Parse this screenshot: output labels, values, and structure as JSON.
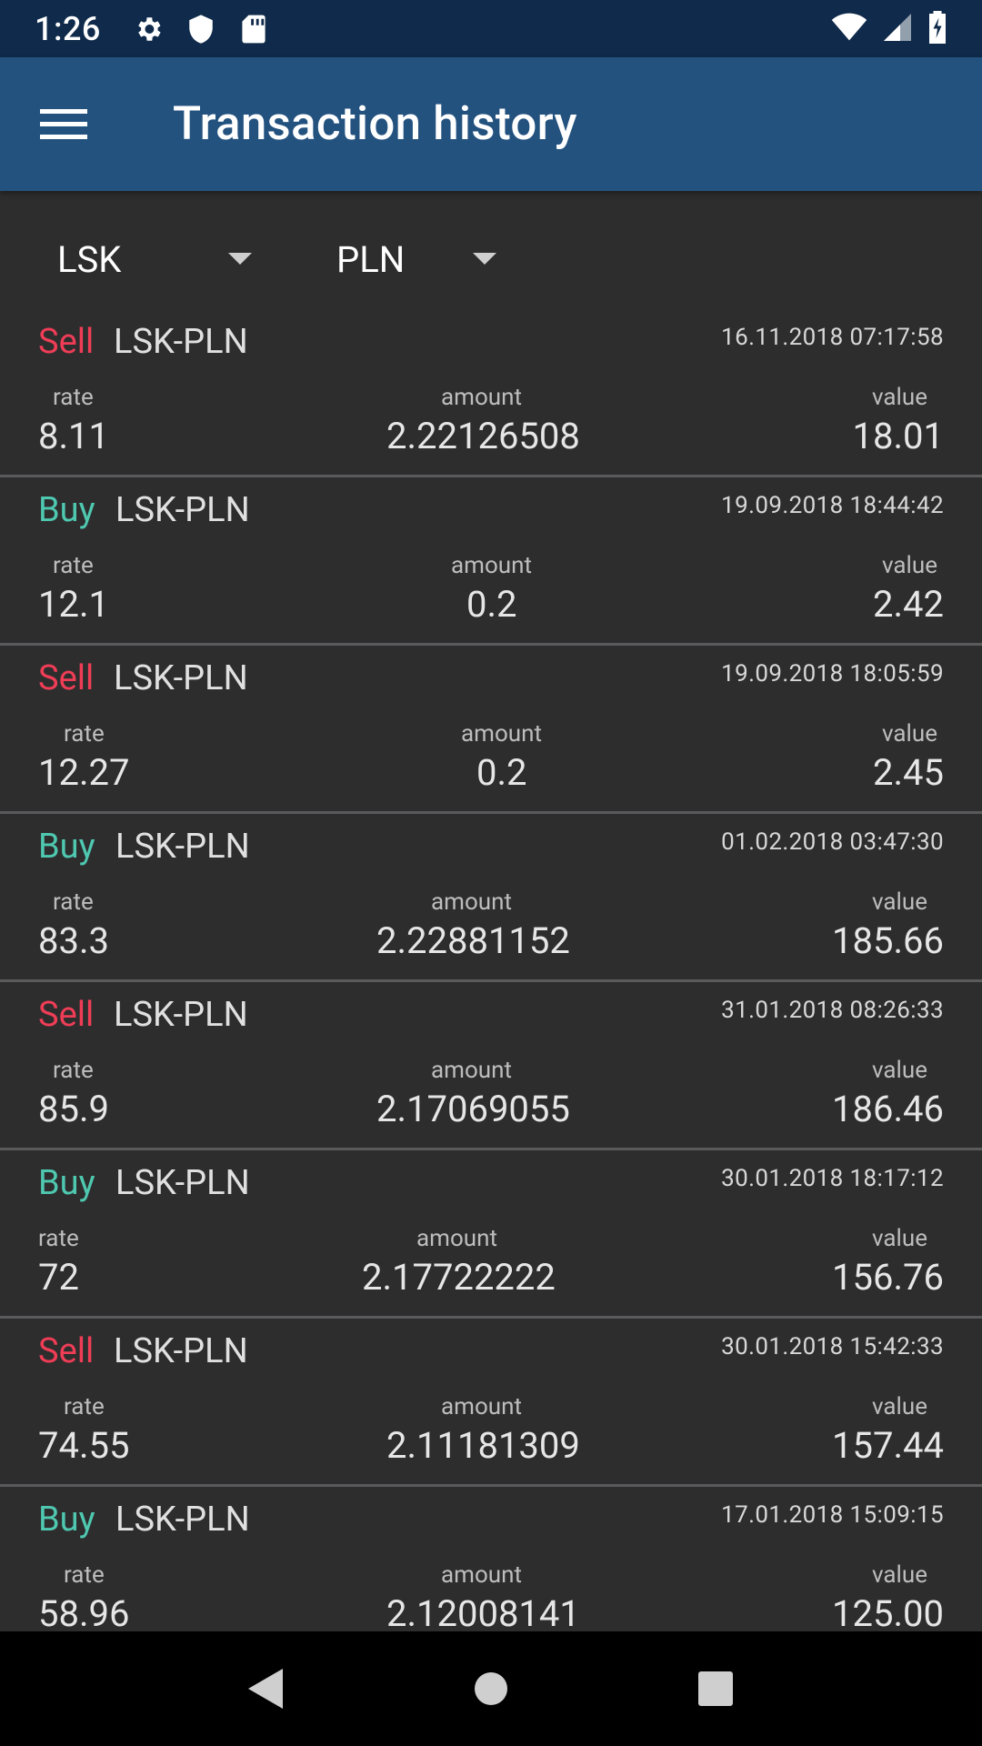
{
  "status_bar": {
    "time": "1:26",
    "icons": [
      "gear-icon",
      "shield-icon",
      "sd-card-icon",
      "wifi-icon",
      "signal-icon",
      "battery-icon"
    ]
  },
  "app_bar": {
    "title": "Transaction history",
    "menu_icon": "hamburger-menu-icon",
    "color": "#24527f"
  },
  "filters": {
    "currency": "LSK",
    "fiat": "PLN"
  },
  "labels": {
    "rate": "rate",
    "amount": "amount",
    "value": "value"
  },
  "colors": {
    "sell": "#ef3d56",
    "buy": "#4fc8b0",
    "background": "#2d2d2e"
  },
  "transactions": [
    {
      "side": "Sell",
      "pair": "LSK-PLN",
      "date": "16.11.2018 07:17:58",
      "rate": "8.11",
      "amount": "2.22126508",
      "value": "18.01"
    },
    {
      "side": "Buy",
      "pair": "LSK-PLN",
      "date": "19.09.2018 18:44:42",
      "rate": "12.1",
      "amount": "0.2",
      "value": "2.42"
    },
    {
      "side": "Sell",
      "pair": "LSK-PLN",
      "date": "19.09.2018 18:05:59",
      "rate": "12.27",
      "amount": "0.2",
      "value": "2.45"
    },
    {
      "side": "Buy",
      "pair": "LSK-PLN",
      "date": "01.02.2018 03:47:30",
      "rate": "83.3",
      "amount": "2.22881152",
      "value": "185.66"
    },
    {
      "side": "Sell",
      "pair": "LSK-PLN",
      "date": "31.01.2018 08:26:33",
      "rate": "85.9",
      "amount": "2.17069055",
      "value": "186.46"
    },
    {
      "side": "Buy",
      "pair": "LSK-PLN",
      "date": "30.01.2018 18:17:12",
      "rate": "72",
      "amount": "2.17722222",
      "value": "156.76"
    },
    {
      "side": "Sell",
      "pair": "LSK-PLN",
      "date": "30.01.2018 15:42:33",
      "rate": "74.55",
      "amount": "2.11181309",
      "value": "157.44"
    },
    {
      "side": "Buy",
      "pair": "LSK-PLN",
      "date": "17.01.2018 15:09:15",
      "rate": "58.96",
      "amount": "2.12008141",
      "value": "125.00"
    }
  ],
  "nav_bar": {
    "buttons": [
      "back-icon",
      "home-icon",
      "recents-icon"
    ]
  }
}
